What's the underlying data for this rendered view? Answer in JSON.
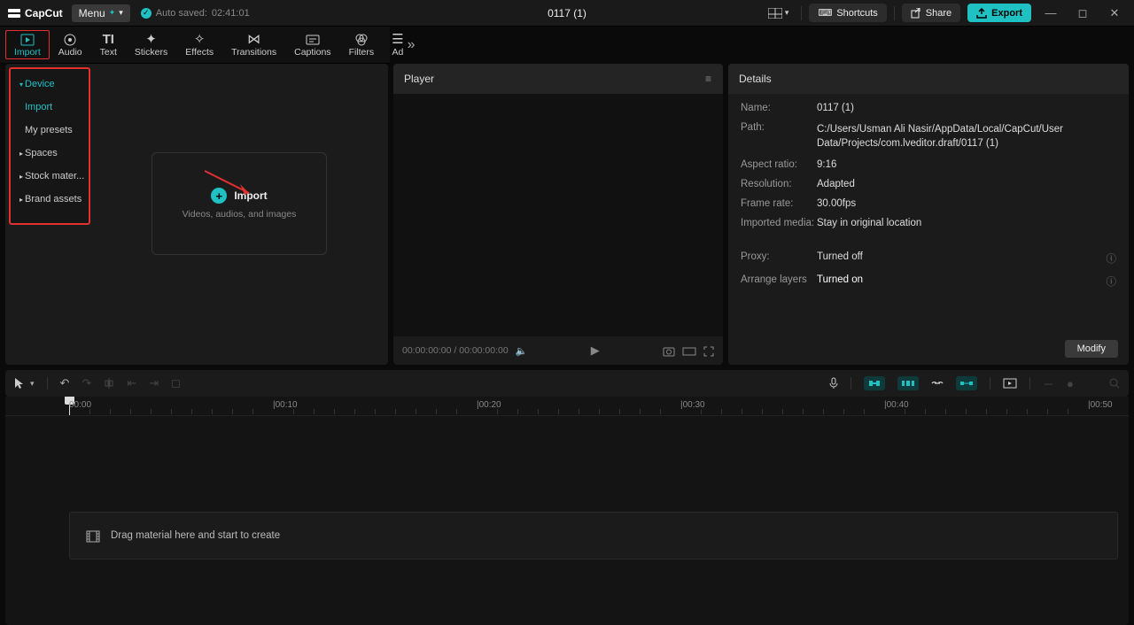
{
  "app": {
    "name": "CapCut",
    "menu_label": "Menu"
  },
  "autosave": {
    "label": "Auto saved:",
    "time": "02:41:01"
  },
  "project_title": "0117 (1)",
  "title_buttons": {
    "shortcuts": "Shortcuts",
    "share": "Share",
    "export": "Export"
  },
  "tabs": [
    {
      "id": "import",
      "label": "Import"
    },
    {
      "id": "audio",
      "label": "Audio"
    },
    {
      "id": "text",
      "label": "Text"
    },
    {
      "id": "stickers",
      "label": "Stickers"
    },
    {
      "id": "effects",
      "label": "Effects"
    },
    {
      "id": "transitions",
      "label": "Transitions"
    },
    {
      "id": "captions",
      "label": "Captions"
    },
    {
      "id": "filters",
      "label": "Filters"
    },
    {
      "id": "ad",
      "label": "Ad"
    }
  ],
  "sidebar": {
    "items": [
      {
        "label": "Device",
        "type": "head"
      },
      {
        "label": "Import",
        "type": "sub-active"
      },
      {
        "label": "My presets",
        "type": "sub"
      },
      {
        "label": "Spaces",
        "type": "head"
      },
      {
        "label": "Stock mater...",
        "type": "head"
      },
      {
        "label": "Brand assets",
        "type": "head"
      }
    ]
  },
  "import_box": {
    "title": "Import",
    "subtitle": "Videos, audios, and images"
  },
  "player": {
    "title": "Player",
    "time_current": "00:00:00:00",
    "time_total": "00:00:00:00"
  },
  "details": {
    "title": "Details",
    "rows": {
      "name": {
        "label": "Name:",
        "value": "0117 (1)"
      },
      "path": {
        "label": "Path:",
        "value": "C:/Users/Usman Ali Nasir/AppData/Local/CapCut/User Data/Projects/com.lveditor.draft/0117 (1)"
      },
      "aspect": {
        "label": "Aspect ratio:",
        "value": "9:16"
      },
      "resolution": {
        "label": "Resolution:",
        "value": "Adapted"
      },
      "framerate": {
        "label": "Frame rate:",
        "value": "30.00fps"
      },
      "imported": {
        "label": "Imported media:",
        "value": "Stay in original location"
      },
      "proxy": {
        "label": "Proxy:",
        "value": "Turned off"
      },
      "layers": {
        "label": "Arrange layers",
        "value": "Turned on"
      }
    },
    "modify": "Modify"
  },
  "timeline": {
    "marks": [
      "00:00",
      "00:10",
      "00:20",
      "00:30",
      "00:40",
      "00:50"
    ],
    "drop_hint": "Drag material here and start to create"
  }
}
